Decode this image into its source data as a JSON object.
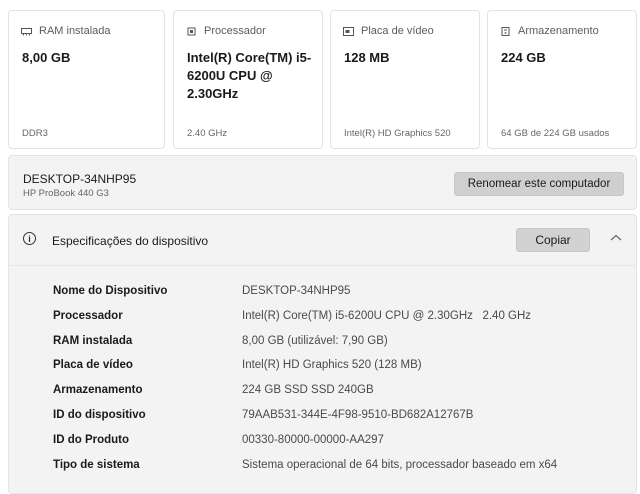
{
  "cards": [
    {
      "icon": "ram-icon",
      "title": "RAM instalada",
      "value": "8,00 GB",
      "sub": "DDR3"
    },
    {
      "icon": "processor-icon",
      "title": "Processador",
      "value": "Intel(R) Core(TM) i5-6200U CPU @ 2.30GHz",
      "sub": "2.40 GHz"
    },
    {
      "icon": "graphics-card-icon",
      "title": "Placa de vídeo",
      "value": "128 MB",
      "sub": "Intel(R) HD Graphics 520"
    },
    {
      "icon": "storage-icon",
      "title": "Armazenamento",
      "value": "224 GB",
      "sub": "64 GB de 224 GB usados"
    }
  ],
  "device": {
    "name": "DESKTOP-34NHP95",
    "model": "HP ProBook 440 G3",
    "rename_label": "Renomear este computador"
  },
  "specs": {
    "title": "Especificações do dispositivo",
    "copy_label": "Copiar",
    "rows": [
      {
        "label": "Nome do Dispositivo",
        "value": "DESKTOP-34NHP95"
      },
      {
        "label": "Processador",
        "value": "Intel(R) Core(TM) i5-6200U CPU @ 2.30GHz   2.40 GHz"
      },
      {
        "label": "RAM instalada",
        "value": "8,00 GB (utilizável: 7,90 GB)"
      },
      {
        "label": "Placa de vídeo",
        "value": "Intel(R) HD Graphics 520 (128 MB)"
      },
      {
        "label": "Armazenamento",
        "value": "224 GB SSD SSD 240GB"
      },
      {
        "label": "ID do dispositivo",
        "value": "79AAB531-344E-4F98-9510-BD682A12767B"
      },
      {
        "label": "ID do Produto",
        "value": "00330-80000-00000-AA297"
      },
      {
        "label": "Tipo de sistema",
        "value": "Sistema operacional de 64 bits, processador baseado em x64"
      }
    ]
  }
}
